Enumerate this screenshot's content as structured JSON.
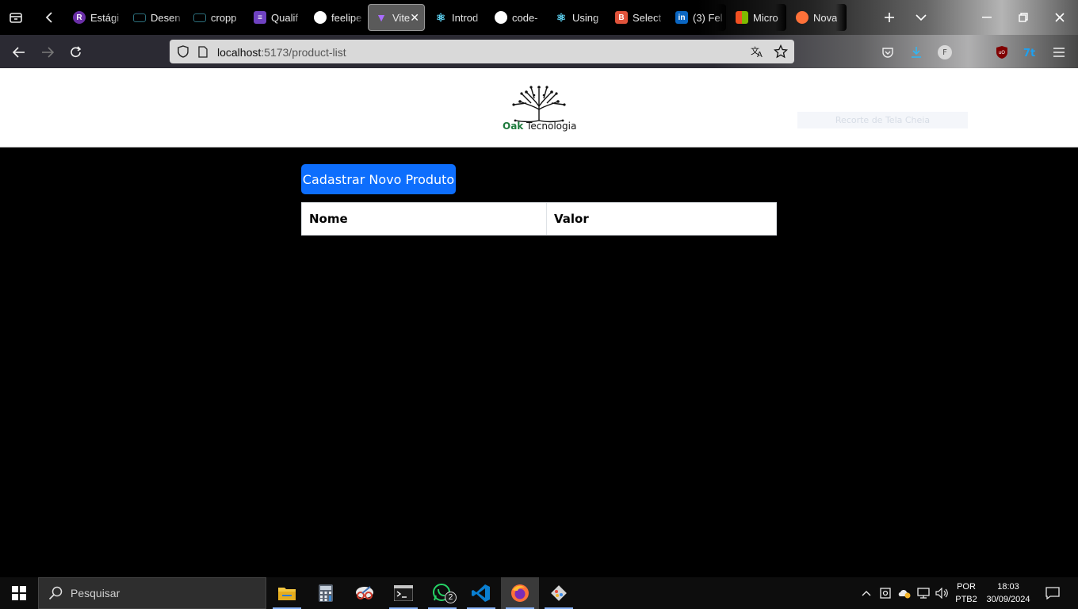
{
  "browser": {
    "tabs": [
      {
        "label": "Estági",
        "icon": "purple-circle-icon",
        "color": "#6b2fa8"
      },
      {
        "label": "Desen",
        "icon": "monitor-icon",
        "color": "#2b6d7a"
      },
      {
        "label": "cropp",
        "icon": "monitor-icon",
        "color": "#2b6d7a"
      },
      {
        "label": "Qualif",
        "icon": "list-icon",
        "color": "#6f42c1"
      },
      {
        "label": "feelipe",
        "icon": "github-icon",
        "color": "#ffffff"
      },
      {
        "label": "Vite",
        "icon": "vite-icon",
        "color": "#a96cff"
      },
      {
        "label": "Introd",
        "icon": "react-icon",
        "color": "#61dafb"
      },
      {
        "label": "code-",
        "icon": "github-icon",
        "color": "#ffffff"
      },
      {
        "label": "Using",
        "icon": "react-icon",
        "color": "#61dafb"
      },
      {
        "label": "Select",
        "icon": "bootstrap-icon",
        "color": "#e0533b"
      },
      {
        "label": "(3) Fel",
        "icon": "linkedin-icon",
        "color": "#0a66c2"
      },
      {
        "label": "Micro",
        "icon": "microsoft-icon",
        "color": "#f25022"
      },
      {
        "label": "Nova",
        "icon": "firefox-icon",
        "color": "#ff7139"
      }
    ],
    "active_tab_index": 5,
    "url_host": "localhost",
    "url_path": ":5173/product-list"
  },
  "page": {
    "logo": {
      "oak": "Oak",
      "tecnologia": " Tecnologia"
    },
    "snip_label": "Recorte de Tela Cheia",
    "new_product_button": "Cadastrar Novo Produto",
    "table": {
      "columns": [
        "Nome",
        "Valor"
      ]
    }
  },
  "taskbar": {
    "search_placeholder": "Pesquisar",
    "whatsapp_badge": "2",
    "lang_top": "POR",
    "lang_bottom": "PTB2",
    "time": "18:03",
    "date": "30/09/2024"
  }
}
